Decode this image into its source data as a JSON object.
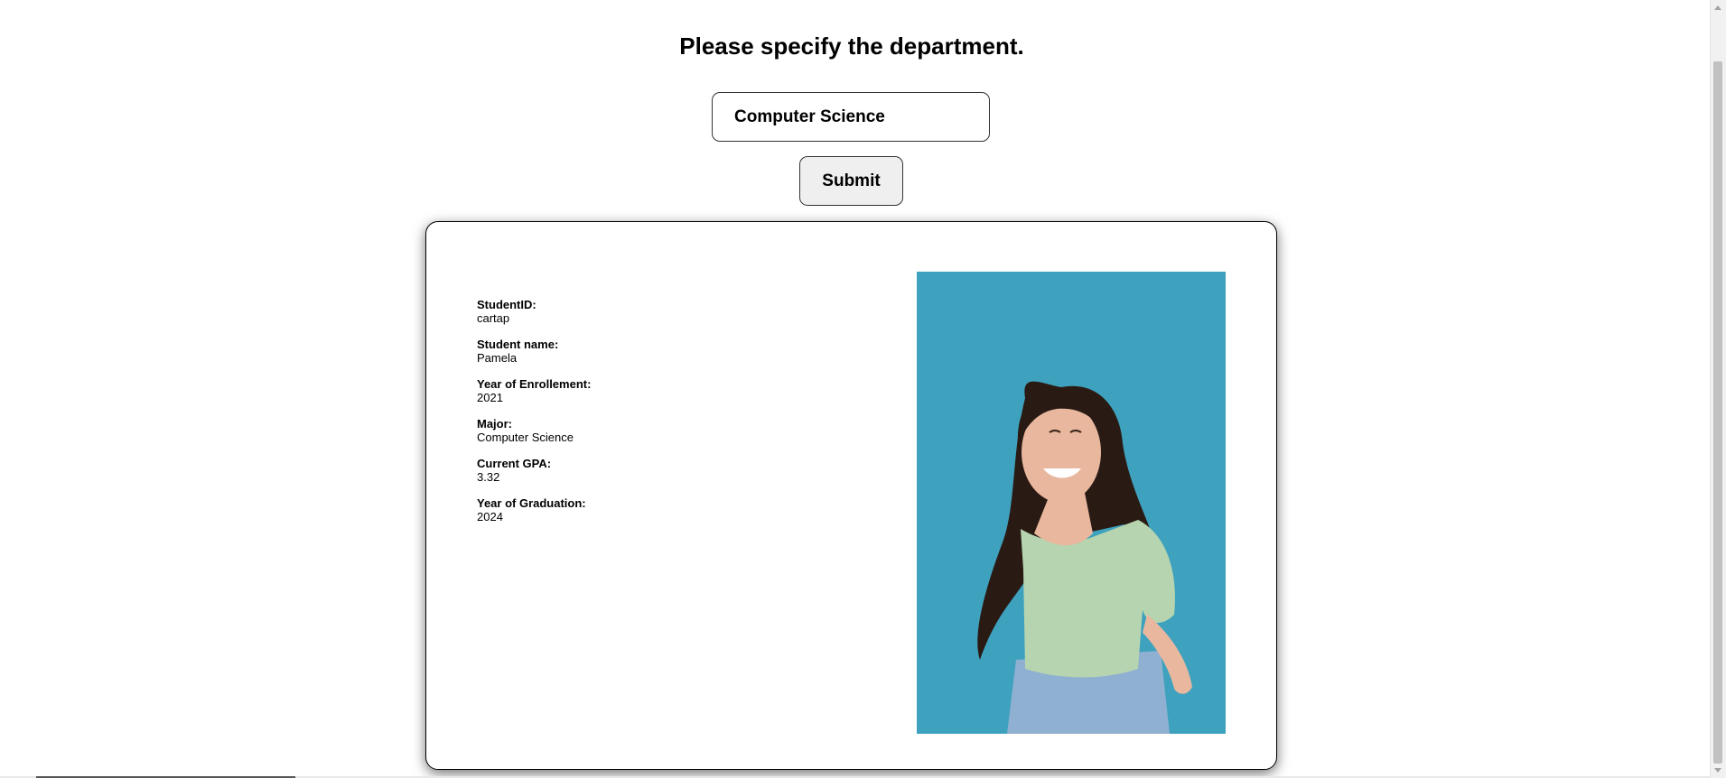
{
  "prompt": "Please specify the department.",
  "department_input": {
    "value": "Computer Science"
  },
  "submit_label": "Submit",
  "student": {
    "fields": [
      {
        "label": "StudentID:",
        "value": "cartap"
      },
      {
        "label": "Student name:",
        "value": "Pamela"
      },
      {
        "label": "Year of Enrollement:",
        "value": "2021"
      },
      {
        "label": "Major:",
        "value": "Computer Science"
      },
      {
        "label": "Current GPA:",
        "value": "3.32"
      },
      {
        "label": "Year of Graduation:",
        "value": "2024"
      }
    ],
    "photo": {
      "background_color": "#3ea2be",
      "shirt_color": "#b7d4b0",
      "jeans_color": "#8fb0d0",
      "hair_color": "#2a1a14",
      "skin_color": "#e8b79e"
    }
  },
  "colors": {
    "card_border": "#000000",
    "button_bg": "#efefef"
  }
}
